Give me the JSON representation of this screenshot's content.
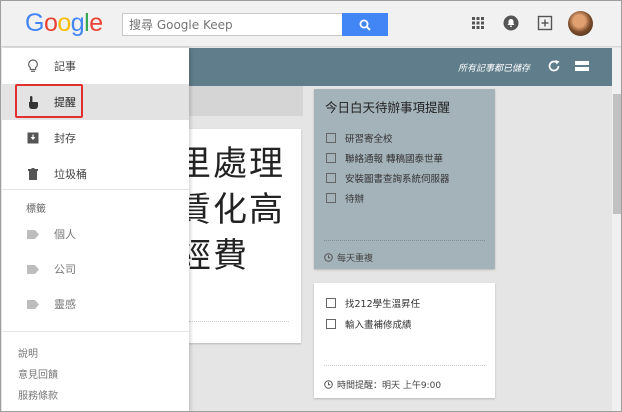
{
  "header": {
    "logo_letters": [
      {
        "ch": "G",
        "color": "#4285f4"
      },
      {
        "ch": "o",
        "color": "#ea4335"
      },
      {
        "ch": "o",
        "color": "#fbbc05"
      },
      {
        "ch": "g",
        "color": "#4285f4"
      },
      {
        "ch": "l",
        "color": "#34a853"
      },
      {
        "ch": "e",
        "color": "#ea4335"
      }
    ],
    "search_placeholder": "搜尋 Google Keep",
    "saved_status": "所有記事都已儲存"
  },
  "sidebar": {
    "items": [
      {
        "label": "記事",
        "icon": "lightbulb-icon"
      },
      {
        "label": "提醒",
        "icon": "hand-pointer-icon"
      },
      {
        "label": "封存",
        "icon": "archive-icon"
      },
      {
        "label": "垃圾桶",
        "icon": "trash-icon"
      }
    ],
    "labels_heading": "標籤",
    "labels": [
      {
        "label": "個人",
        "icon": "label-icon"
      },
      {
        "label": "公司",
        "icon": "label-icon"
      },
      {
        "label": "靈感",
        "icon": "label-icon"
      }
    ],
    "footer": [
      "說明",
      "意見回饋",
      "服務條款"
    ]
  },
  "background_note": {
    "lines": [
      "里處理",
      "賃化高",
      "經費"
    ]
  },
  "notes": [
    {
      "title": "今日白天待辦事項提醒",
      "items": [
        "研習寄全校",
        "聯絡通報 轉稿國泰世華",
        "安裝圖書查詢系統伺服器",
        "待辦"
      ],
      "meta": "每天重複",
      "color": "#a4b2ba"
    },
    {
      "items": [
        "找212學生溫昇任",
        "輸入畫補修成績"
      ],
      "meta": "時間提醒：明天 上午9:00",
      "color": "#ffffff"
    }
  ],
  "colors": {
    "accent": "#4285f4",
    "header_strip": "#5f7d8a",
    "highlight": "#e03030"
  }
}
